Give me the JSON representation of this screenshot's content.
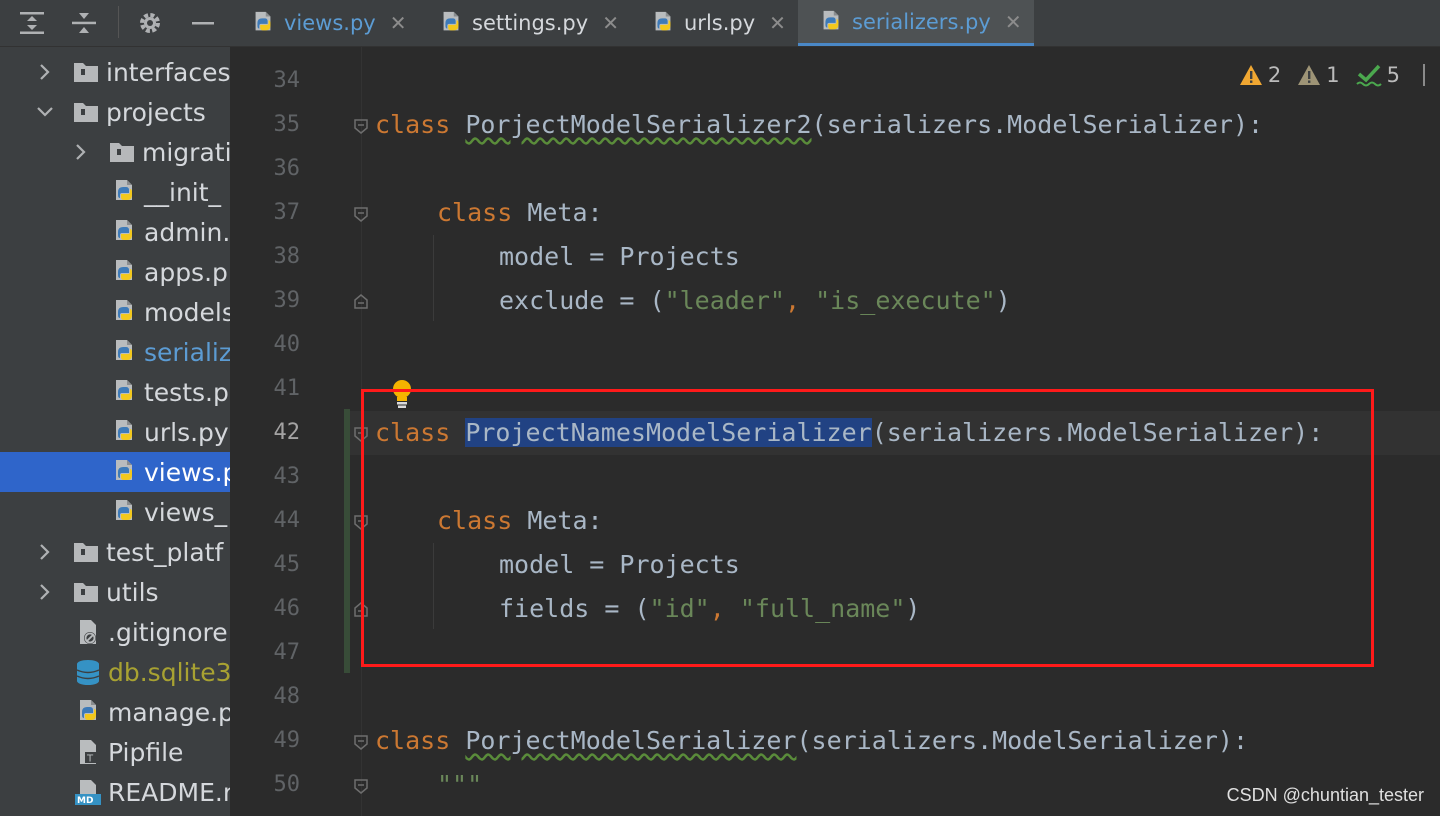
{
  "tabs": [
    {
      "label": "views.py",
      "active": false,
      "modified": true
    },
    {
      "label": "settings.py",
      "active": false,
      "modified": false
    },
    {
      "label": "urls.py",
      "active": false,
      "modified": false
    },
    {
      "label": "serializers.py",
      "active": true,
      "modified": true
    }
  ],
  "tab_close_glyph": "✕",
  "inspections": {
    "warnings": "2",
    "weak_warnings": "1",
    "typos": "5"
  },
  "tree": [
    {
      "label": "interfaces",
      "kind": "folder",
      "state": "collapsed"
    },
    {
      "label": "projects",
      "kind": "folder",
      "state": "expanded"
    },
    {
      "label": "migrati",
      "kind": "folder",
      "state": "collapsed"
    },
    {
      "label": "__init_",
      "kind": "python"
    },
    {
      "label": "admin.",
      "kind": "python"
    },
    {
      "label": "apps.p",
      "kind": "python"
    },
    {
      "label": "models",
      "kind": "python"
    },
    {
      "label": "serializ",
      "kind": "python",
      "modified": true
    },
    {
      "label": "tests.p",
      "kind": "python"
    },
    {
      "label": "urls.py",
      "kind": "python"
    },
    {
      "label": "views.py",
      "kind": "python",
      "selected": true
    },
    {
      "label": "views_",
      "kind": "python"
    },
    {
      "label": "test_platf",
      "kind": "folder",
      "state": "collapsed"
    },
    {
      "label": "utils",
      "kind": "folder",
      "state": "collapsed"
    },
    {
      "label": ".gitignore",
      "kind": "gitignore"
    },
    {
      "label": "db.sqlite3",
      "kind": "database"
    },
    {
      "label": "manage.p",
      "kind": "python"
    },
    {
      "label": "Pipfile",
      "kind": "pipfile"
    },
    {
      "label": "README.r",
      "kind": "markdown"
    }
  ],
  "code": {
    "line_numbers": [
      "34",
      "35",
      "36",
      "37",
      "38",
      "39",
      "40",
      "41",
      "42",
      "43",
      "44",
      "45",
      "46",
      "47",
      "48",
      "49",
      "50"
    ],
    "current_line": "42",
    "l35": {
      "kw": "class",
      "name": "PorjectModelSerializer2",
      "rest": "(serializers.ModelSerializer):"
    },
    "l37": {
      "kw": "class",
      "rest": " Meta:"
    },
    "l38": {
      "text": "model = Projects"
    },
    "l39": {
      "pre": "exclude = (",
      "s1": "\"leader\"",
      "sep": ", ",
      "s2": "\"is_execute\"",
      "post": ")"
    },
    "l42": {
      "kw": "class",
      "name": "ProjectNamesModelSerializer",
      "rest": "(serializers.ModelSerializer):"
    },
    "l44": {
      "kw": "class",
      "rest": " Meta:"
    },
    "l45": {
      "text": "model = Projects"
    },
    "l46": {
      "pre": "fields = (",
      "s1": "\"id\"",
      "sep": ", ",
      "s2": "\"full_name\"",
      "post": ")"
    },
    "l49": {
      "kw": "class",
      "name": "PorjectModelSerializer",
      "rest": "(serializers.ModelSerializer):"
    },
    "l50": {
      "text": "\"\"\""
    }
  },
  "colors": {
    "keyword": "#cc7832",
    "string": "#6a8759",
    "selection": "#214283",
    "highlight": "#ff1a1a",
    "accent": "#2f65ca"
  },
  "watermark": "CSDN @chuntian_tester"
}
